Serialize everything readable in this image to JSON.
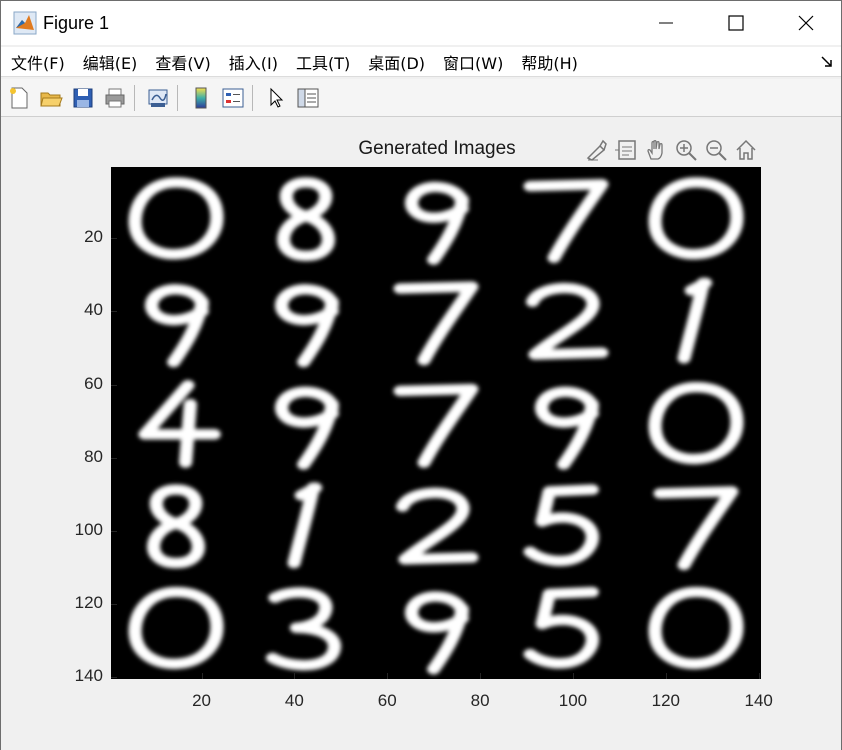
{
  "window": {
    "title": "Figure 1"
  },
  "menu": [
    "文件(F)",
    "编辑(E)",
    "查看(V)",
    "插入(I)",
    "工具(T)",
    "桌面(D)",
    "窗口(W)",
    "帮助(H)"
  ],
  "toolbar": {
    "icons": [
      "new-figure-icon",
      "open-file-icon",
      "save-icon",
      "print-icon",
      "link-plot-icon",
      "colorbar-icon",
      "legend-icon",
      "select-pointer-icon",
      "property-inspector-icon"
    ]
  },
  "axes_toolbar": {
    "icons": [
      "brush-icon",
      "data-tips-icon",
      "pan-hand-icon",
      "zoom-in-icon",
      "zoom-out-icon",
      "home-icon"
    ]
  },
  "chart_data": {
    "type": "image",
    "title": "Generated Images",
    "xlabel": "",
    "ylabel": "",
    "xlim": [
      0.5,
      140.5
    ],
    "ylim": [
      0.5,
      140.5
    ],
    "y_reversed": true,
    "colormap": "gray",
    "xticks": [
      20,
      40,
      60,
      80,
      100,
      120,
      140
    ],
    "yticks": [
      20,
      40,
      60,
      80,
      100,
      120,
      140
    ],
    "grid_rows": 5,
    "grid_cols": 5,
    "digits": [
      [
        "0",
        "8",
        "9",
        "7",
        "0"
      ],
      [
        "9",
        "9",
        "7",
        "2",
        "1"
      ],
      [
        "4",
        "9",
        "7",
        "9",
        "0"
      ],
      [
        "8",
        "1",
        "2",
        "5",
        "7"
      ],
      [
        "0",
        "3",
        "9",
        "5",
        "0"
      ]
    ]
  }
}
